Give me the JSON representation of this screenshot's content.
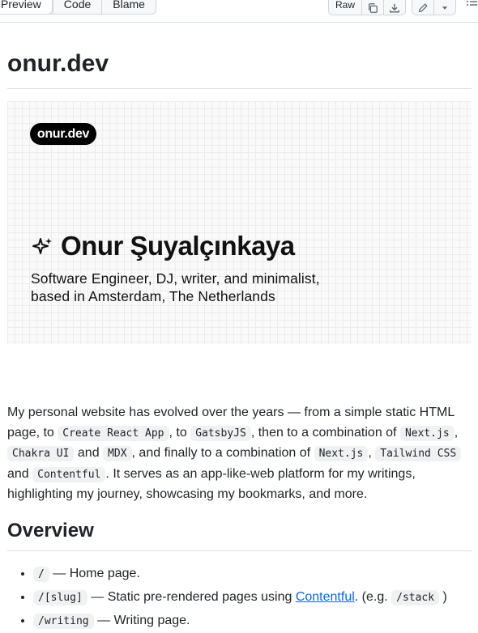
{
  "toolbar": {
    "tabs": [
      "Preview",
      "Code",
      "Blame"
    ],
    "raw_label": "Raw",
    "icons": [
      "copy-icon",
      "download-icon",
      "pencil-icon",
      "triangle-down-icon",
      "list-icon"
    ]
  },
  "readme": {
    "title": "onur.dev",
    "banner": {
      "pill_text": "onur.dev",
      "name": "Onur Şuyalçınkaya",
      "subtitle_line1": "Software Engineer, DJ, writer, and minimalist,",
      "subtitle_line2": "based in Amsterdam, The Netherlands"
    },
    "intro": {
      "t1": "My personal website has evolved over the years — from a simple static HTML page, to ",
      "c1": "Create React App",
      "t2": ", to ",
      "c2": "GatsbyJS",
      "t3": ", then to a combination of ",
      "c3": "Next.js",
      "t4": ", ",
      "c4": "Chakra UI",
      "t5": " and ",
      "c5": "MDX",
      "t6": ", and finally to a combination of ",
      "c6": "Next.js",
      "t7": ", ",
      "c7": "Tailwind CSS",
      "t8": " and ",
      "c8": "Contentful",
      "t9": ". It serves as an app-like-web platform for my writings, highlighting my journey, showcasing my bookmarks, and more."
    },
    "overview_heading": "Overview",
    "overview": [
      {
        "code": "/",
        "text": " — Home page."
      },
      {
        "code": "/[slug]",
        "text_before": " — Static pre-rendered pages using ",
        "link": "Contentful",
        "text_after": ". (e.g. ",
        "code2": "/stack",
        "text_end": ")"
      },
      {
        "code": "/writing",
        "text": " — Writing page."
      }
    ]
  },
  "colors": {
    "link": "#0969da",
    "text": "#1f2328",
    "border": "#d0d7de",
    "code_bg": "#eff1f3"
  }
}
